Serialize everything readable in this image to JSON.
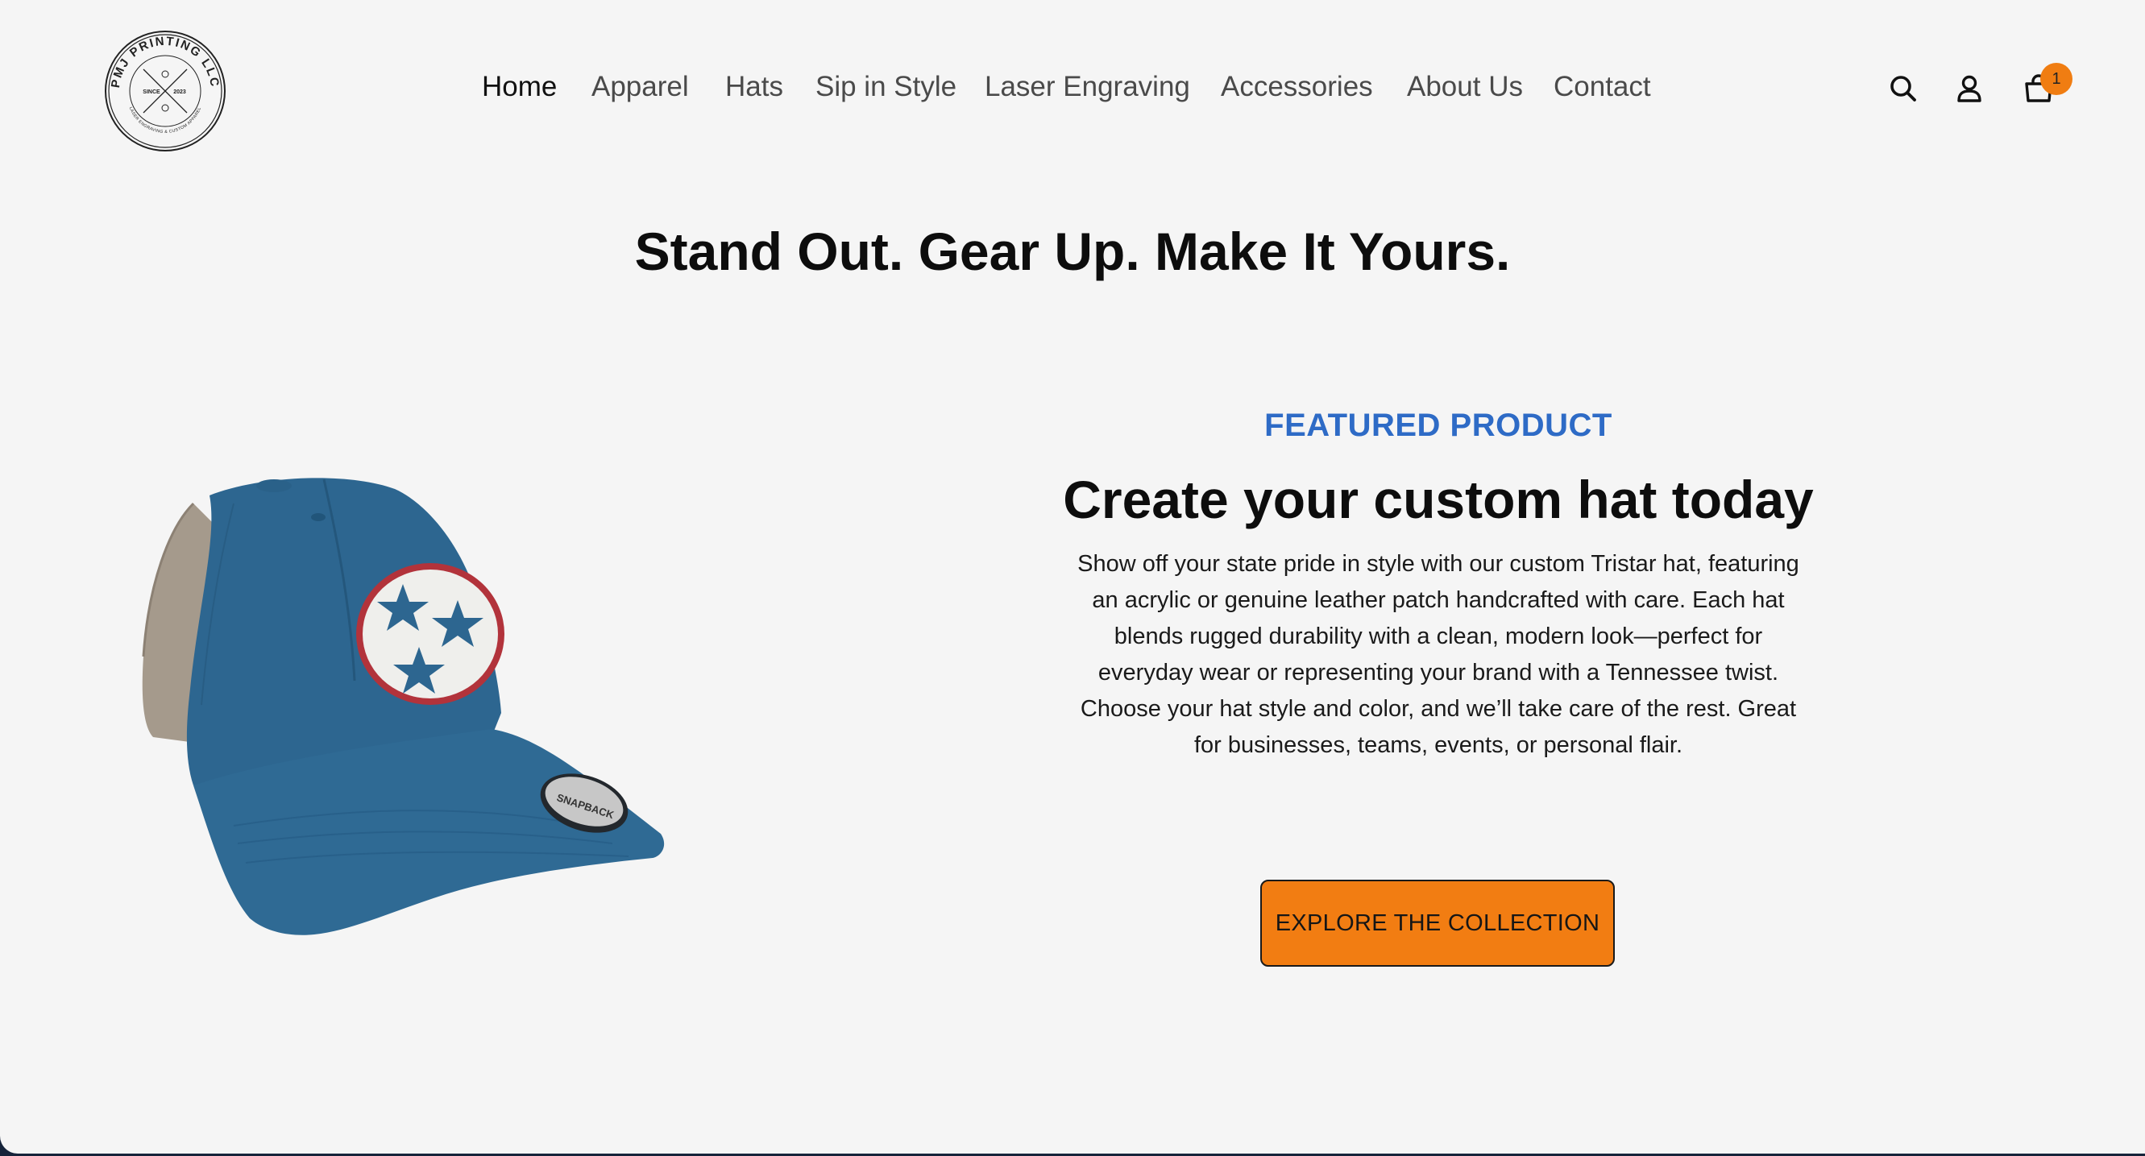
{
  "brand": {
    "logo_name": "PMJ PRINTING LLC",
    "logo_since": "SINCE",
    "logo_year": "2023",
    "logo_tagline": "LASER ENGRAVING & CUSTOM APPAREL"
  },
  "nav": {
    "items": [
      {
        "label": "Home",
        "active": true
      },
      {
        "label": "Apparel",
        "active": false
      },
      {
        "label": "Hats",
        "active": false
      },
      {
        "label": "Sip in Style",
        "active": false
      },
      {
        "label": "Laser Engraving",
        "active": false
      },
      {
        "label": "Accessories",
        "active": false
      },
      {
        "label": "About Us",
        "active": false
      },
      {
        "label": "Contact",
        "active": false
      }
    ]
  },
  "header_icons": {
    "search": "search-icon",
    "account": "user-icon",
    "cart": "cart-icon",
    "cart_count": "1"
  },
  "hero": {
    "title": "Stand Out. Gear Up. Make It Yours."
  },
  "featured": {
    "eyebrow": "FEATURED PRODUCT",
    "title": "Create your custom hat today",
    "description": "Show off your state pride in style with our custom Tristar hat, featuring an acrylic or genuine leather patch handcrafted with care. Each hat blends rugged durability with a clean, modern look—perfect for everyday wear or representing your brand with a Tennessee twist. Choose your hat style and color, and we’ll take care of the rest. Great for businesses, teams, events, or personal flair.",
    "cta_label": "EXPLORE THE COLLECTION",
    "image": "tristar-hat-image",
    "hat_label": "SNAPBACK"
  },
  "colors": {
    "page_bg": "#f5f5f5",
    "accent_orange": "#f27d12",
    "eyebrow_blue": "#2e6bc6",
    "hat_blue": "#2d6690",
    "mesh": "#a59a8c"
  }
}
